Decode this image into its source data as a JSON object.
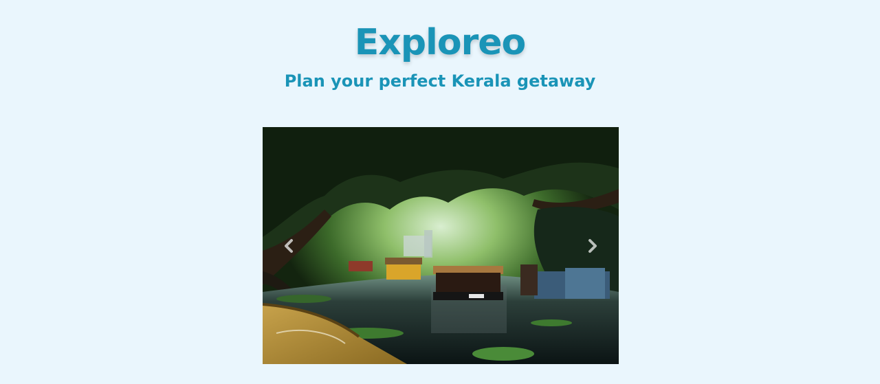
{
  "site": {
    "brand": "Exploreo",
    "tagline": "Plan your perfect Kerala getaway"
  },
  "carousel": {
    "image_icon": "kerala-backwaters-houseboats-photo",
    "prev_icon": "chevron-left-icon",
    "next_icon": "chevron-right-icon",
    "colors": {
      "background": "#eaf6fd",
      "accent": "#1a94b7"
    }
  }
}
